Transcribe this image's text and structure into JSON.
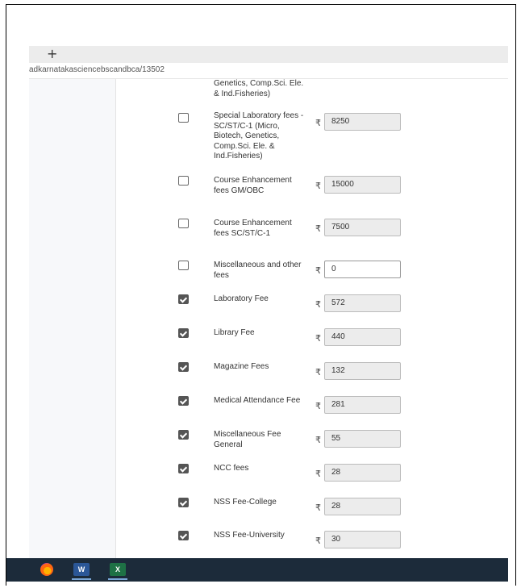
{
  "browser": {
    "new_tab_label": "+",
    "url": "adkarnatakasciencebscandbca/13502"
  },
  "fees": [
    {
      "label": "Genetics, Comp.Sci. Ele. & Ind.Fisheries)",
      "checked": null,
      "amount": null,
      "editable": false
    },
    {
      "label": "Special Laboratory fees - SC/ST/C-1 (Micro, Biotech, Genetics, Comp.Sci. Ele. & Ind.Fisheries)",
      "checked": false,
      "amount": "8250",
      "editable": false
    },
    {
      "label": "Course Enhancement fees GM/OBC",
      "checked": false,
      "amount": "15000",
      "editable": false
    },
    {
      "label": "Course Enhancement fees SC/ST/C-1",
      "checked": false,
      "amount": "7500",
      "editable": false
    },
    {
      "label": "Miscellaneous and other fees",
      "checked": false,
      "amount": "0",
      "editable": true
    },
    {
      "label": "Laboratory Fee",
      "checked": true,
      "amount": "572",
      "editable": false
    },
    {
      "label": "Library Fee",
      "checked": true,
      "amount": "440",
      "editable": false
    },
    {
      "label": "Magazine Fees",
      "checked": true,
      "amount": "132",
      "editable": false
    },
    {
      "label": "Medical Attendance Fee",
      "checked": true,
      "amount": "281",
      "editable": false
    },
    {
      "label": "Miscellaneous Fee General",
      "checked": true,
      "amount": "55",
      "editable": false
    },
    {
      "label": "NCC fees",
      "checked": true,
      "amount": "28",
      "editable": false
    },
    {
      "label": "NSS Fee-College",
      "checked": true,
      "amount": "28",
      "editable": false
    },
    {
      "label": "NSS Fee-University",
      "checked": true,
      "amount": "30",
      "editable": false
    }
  ],
  "currency_symbol": "₹",
  "taskbar": {
    "apps": [
      {
        "name": "firefox-icon"
      },
      {
        "name": "word-icon",
        "text": "W"
      },
      {
        "name": "excel-icon",
        "text": "X"
      }
    ]
  }
}
